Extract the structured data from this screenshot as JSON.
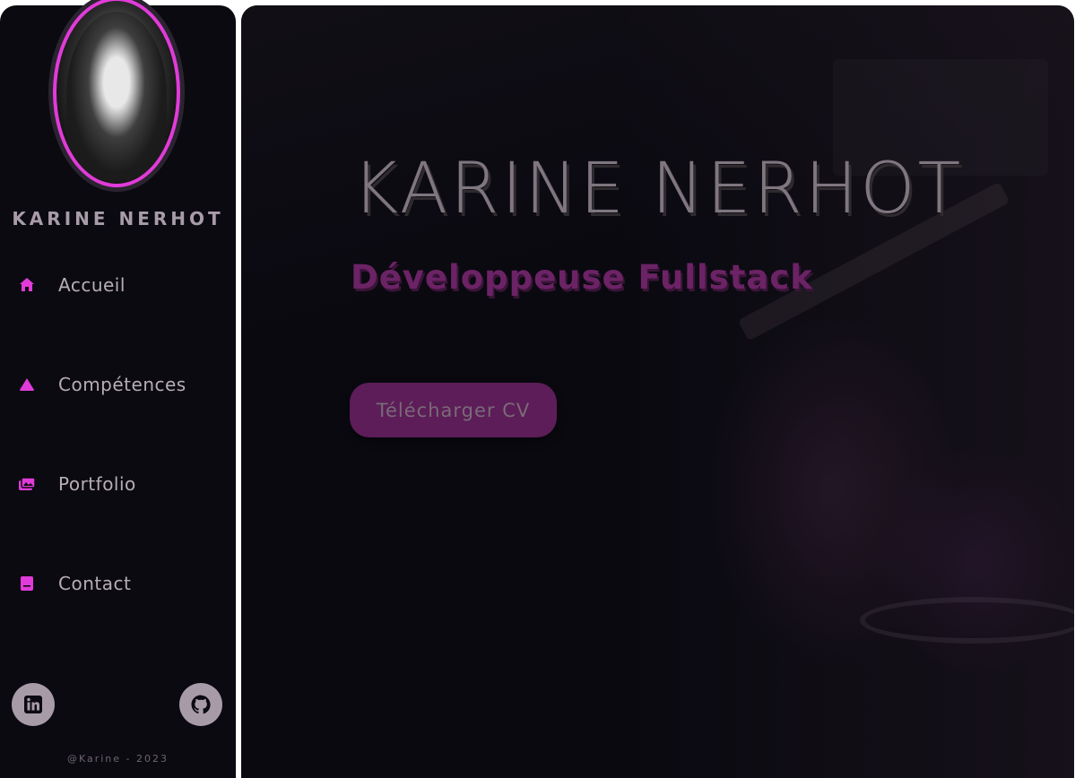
{
  "sidebar": {
    "name": "KARINE NERHOT",
    "nav": [
      {
        "label": "Accueil",
        "icon": "home-icon"
      },
      {
        "label": "Compétences",
        "icon": "triangle-icon"
      },
      {
        "label": "Portfolio",
        "icon": "images-icon"
      },
      {
        "label": "Contact",
        "icon": "address-book-icon"
      }
    ],
    "social": [
      {
        "icon": "linkedin-icon"
      },
      {
        "icon": "github-icon"
      }
    ],
    "copyright": "@Karine - 2023"
  },
  "hero": {
    "title": "KARINE NERHOT",
    "subtitle": "Développeuse Fullstack",
    "button_label": "Télécharger CV"
  },
  "colors": {
    "accent": "#e13bd9",
    "subtitle": "#6c2366",
    "button": "#5c1d58",
    "sidebar_bg": "#0b0a10",
    "main_bg": "#0a0910"
  }
}
